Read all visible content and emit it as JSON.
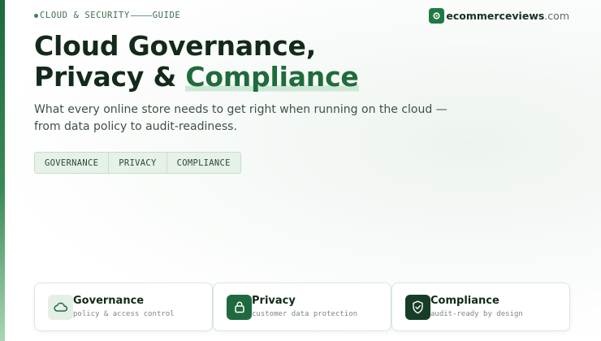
{
  "eyebrow": {
    "left": "CLOUD & SECURITY",
    "right": "GUIDE"
  },
  "brand": {
    "name": "ecommerceviews",
    "tld": ".com"
  },
  "title": {
    "line1": "Cloud Governance,",
    "line2_prefix": "Privacy & ",
    "line2_highlight": "Compliance"
  },
  "subtitle": {
    "line1": "What every online store needs to get right when running on the cloud —",
    "line2": "from data policy to audit-readiness."
  },
  "chips": [
    "GOVERNANCE",
    "PRIVACY",
    "COMPLIANCE"
  ],
  "cards": [
    {
      "title": "Governance",
      "subtitle": "policy & access control",
      "icon": "cloud-icon"
    },
    {
      "title": "Privacy",
      "subtitle": "customer data protection",
      "icon": "lock-icon"
    },
    {
      "title": "Compliance",
      "subtitle": "audit-ready by design",
      "icon": "shield-check-icon"
    }
  ],
  "colors": {
    "accent": "#1e7a44",
    "highlight": "#1f6b3b",
    "dark": "#132a1b"
  }
}
